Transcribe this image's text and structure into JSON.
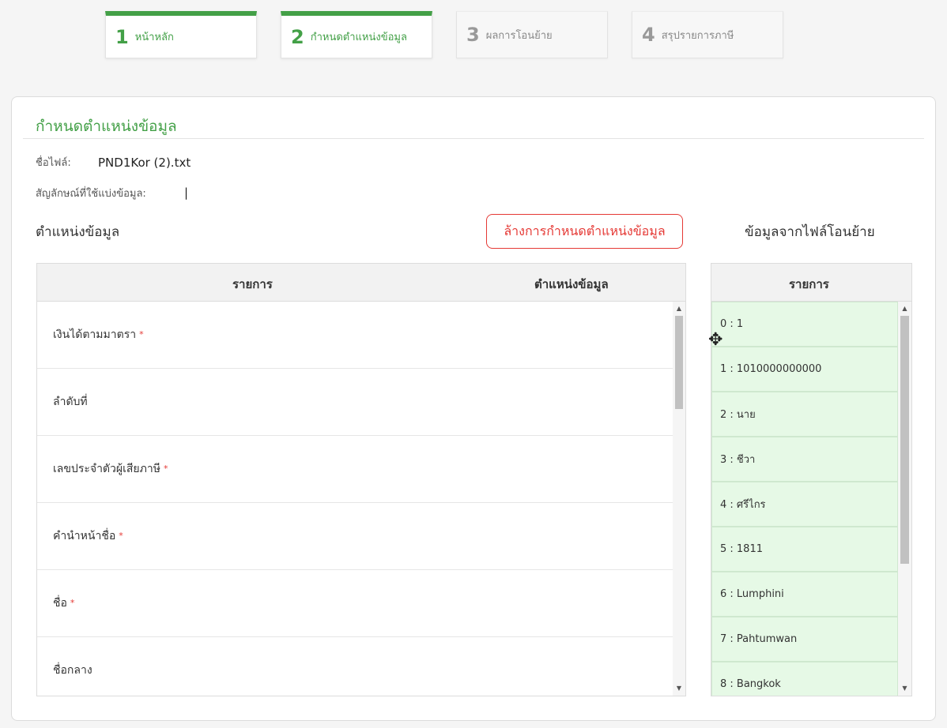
{
  "steps": [
    {
      "num": "1",
      "label": "หน้าหลัก",
      "state": "active"
    },
    {
      "num": "2",
      "label": "กำหนดตำแหน่งข้อมูล",
      "state": "active"
    },
    {
      "num": "3",
      "label": "ผลการโอนย้าย",
      "state": "inactive"
    },
    {
      "num": "4",
      "label": "สรุปรายการภาษี",
      "state": "inactive"
    }
  ],
  "card": {
    "title": "กำหนดตำแหน่งข้อมูล",
    "file_label": "ชื่อไฟล์:",
    "file_name": "PND1Kor (2).txt",
    "delimiter_label": "สัญลักษณ์ที่ใช้แบ่งข้อมูล:",
    "delimiter_value": "|",
    "positions_title": "ตำแหน่งข้อมูล",
    "clear_button": "ล้างการกำหนดตำแหน่งข้อมูล",
    "source_title": "ข้อมูลจากไฟล์โอนย้าย"
  },
  "left_table": {
    "col_item": "รายการ",
    "col_position": "ตำแหน่งข้อมูล",
    "rows": [
      {
        "label": "เงินได้ตามมาตรา",
        "required": "*"
      },
      {
        "label": "ลำดับที่",
        "required": ""
      },
      {
        "label": "เลขประจำตัวผู้เสียภาษี",
        "required": "*"
      },
      {
        "label": "คำนำหน้าชื่อ",
        "required": "*"
      },
      {
        "label": "ชื่อ",
        "required": "*"
      },
      {
        "label": "ชื่อกลาง",
        "required": ""
      }
    ]
  },
  "right_table": {
    "col_item": "รายการ",
    "items": [
      "0 : 1",
      "1 : 1010000000000",
      "2 : นาย",
      "3 : ชีวา",
      "4 : ศรีไกร",
      "5 : 1811",
      "6 : Lumphini",
      "7 : Pahtumwan",
      "8 : Bangkok"
    ]
  },
  "colors": {
    "accent": "#43a047",
    "danger": "#e53935",
    "item_bg": "#e6f9e6"
  },
  "icons": {
    "cursor": "move-cursor-icon",
    "scroll_up": "arrow-up-icon",
    "scroll_down": "arrow-down-icon"
  }
}
